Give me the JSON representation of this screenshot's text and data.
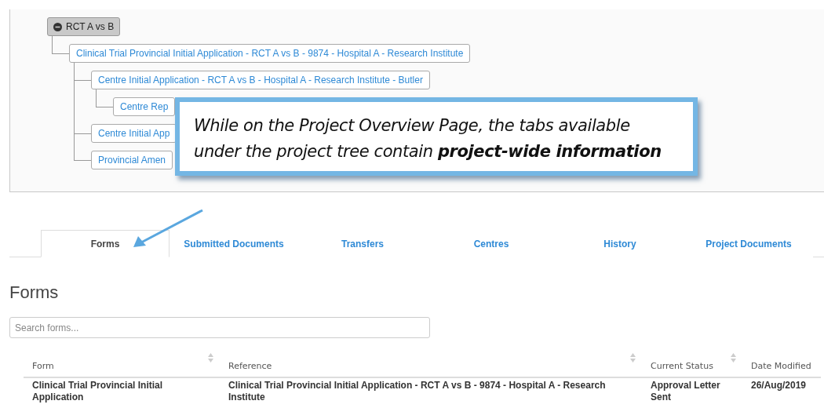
{
  "tree": {
    "label": "RCT A vs B",
    "expanded": true,
    "children": [
      {
        "label": "Clinical Trial Provincial Initial Application - RCT A vs B - 9874 - Hospital A - Research Institute",
        "children": [
          {
            "label": "Centre Initial Application - RCT A vs B - Hospital A - Research Institute - Butler",
            "children": [
              {
                "label": "Centre Rep"
              }
            ]
          },
          {
            "label": "Centre Initial App"
          },
          {
            "label": "Provincial Amen"
          }
        ]
      }
    ]
  },
  "callout": {
    "text": "While on the Project Overview Page, the tabs available under the project tree contain **project-wide information**"
  },
  "tabs": [
    {
      "label": "Forms",
      "selected": true
    },
    {
      "label": "Submitted Documents",
      "selected": false
    },
    {
      "label": "Transfers",
      "selected": false
    },
    {
      "label": "Centres",
      "selected": false
    },
    {
      "label": "History",
      "selected": false
    },
    {
      "label": "Project Documents",
      "selected": false
    }
  ],
  "section_title": "Forms",
  "search": {
    "placeholder": "Search forms..."
  },
  "table": {
    "columns": [
      {
        "label": "Form",
        "sortable": true
      },
      {
        "label": "Reference",
        "sortable": true
      },
      {
        "label": "Current Status",
        "sortable": true
      },
      {
        "label": "Date Modified",
        "sortable": false
      }
    ],
    "rows": [
      [
        "Clinical Trial Provincial Initial Application",
        "Clinical Trial Provincial Initial Application - RCT A vs B - 9874 - Hospital A - Research Institute",
        "Approval Letter Sent",
        "26/Aug/2019"
      ]
    ]
  }
}
